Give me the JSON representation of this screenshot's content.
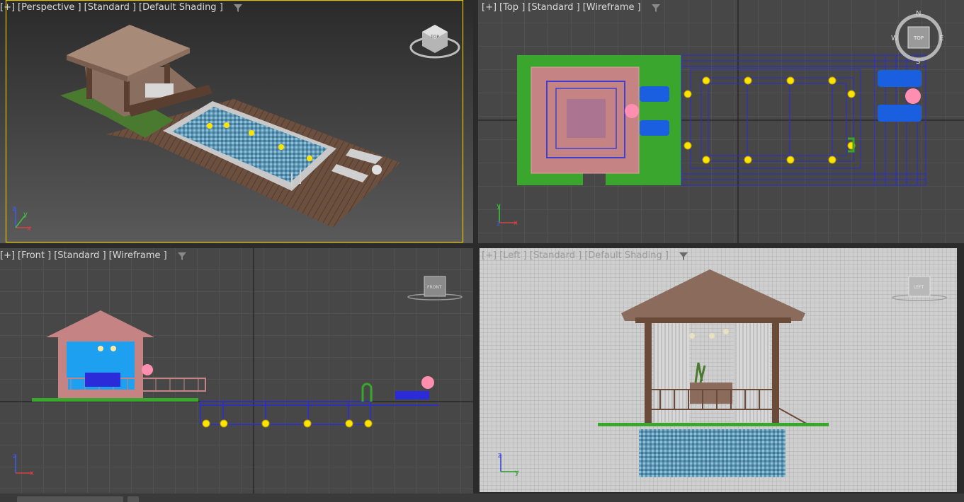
{
  "viewports": {
    "perspective": {
      "label_parts": [
        "[+]",
        "[Perspective ]",
        "[Standard ]",
        "[Default Shading ]"
      ],
      "viewcube_text": "TOP",
      "active": true,
      "background": "#3f3f3f"
    },
    "top": {
      "label_parts": [
        "[+]",
        "[Top ]",
        "[Standard ]",
        "[Wireframe ]"
      ],
      "viewcube_text": "TOP",
      "compass": {
        "n": "N",
        "s": "S",
        "e": "E",
        "w": "W"
      },
      "background": "#444444"
    },
    "front": {
      "label_parts": [
        "[+]",
        "[Front ]",
        "[Standard ]",
        "[Wireframe ]"
      ],
      "viewcube_text": "FRONT",
      "background": "#444444"
    },
    "left": {
      "label_parts": [
        "[+]",
        "[Left ]",
        "[Standard ]",
        "[Default Shading ]"
      ],
      "viewcube_text": "LEFT",
      "background": "#c8c8c8"
    }
  },
  "axis_labels": {
    "x": "x",
    "y": "y",
    "z": "z"
  },
  "colors": {
    "label_text": "#d9d9d9",
    "active_border": "#e3c200",
    "grid": "#5a5a5a",
    "grid_axis": "#1a1a1a",
    "wire_blue": "#2b2bd9",
    "wire_pink": "#c68383",
    "wire_green": "#3aa62e",
    "wire_yellow": "#ffe400"
  }
}
